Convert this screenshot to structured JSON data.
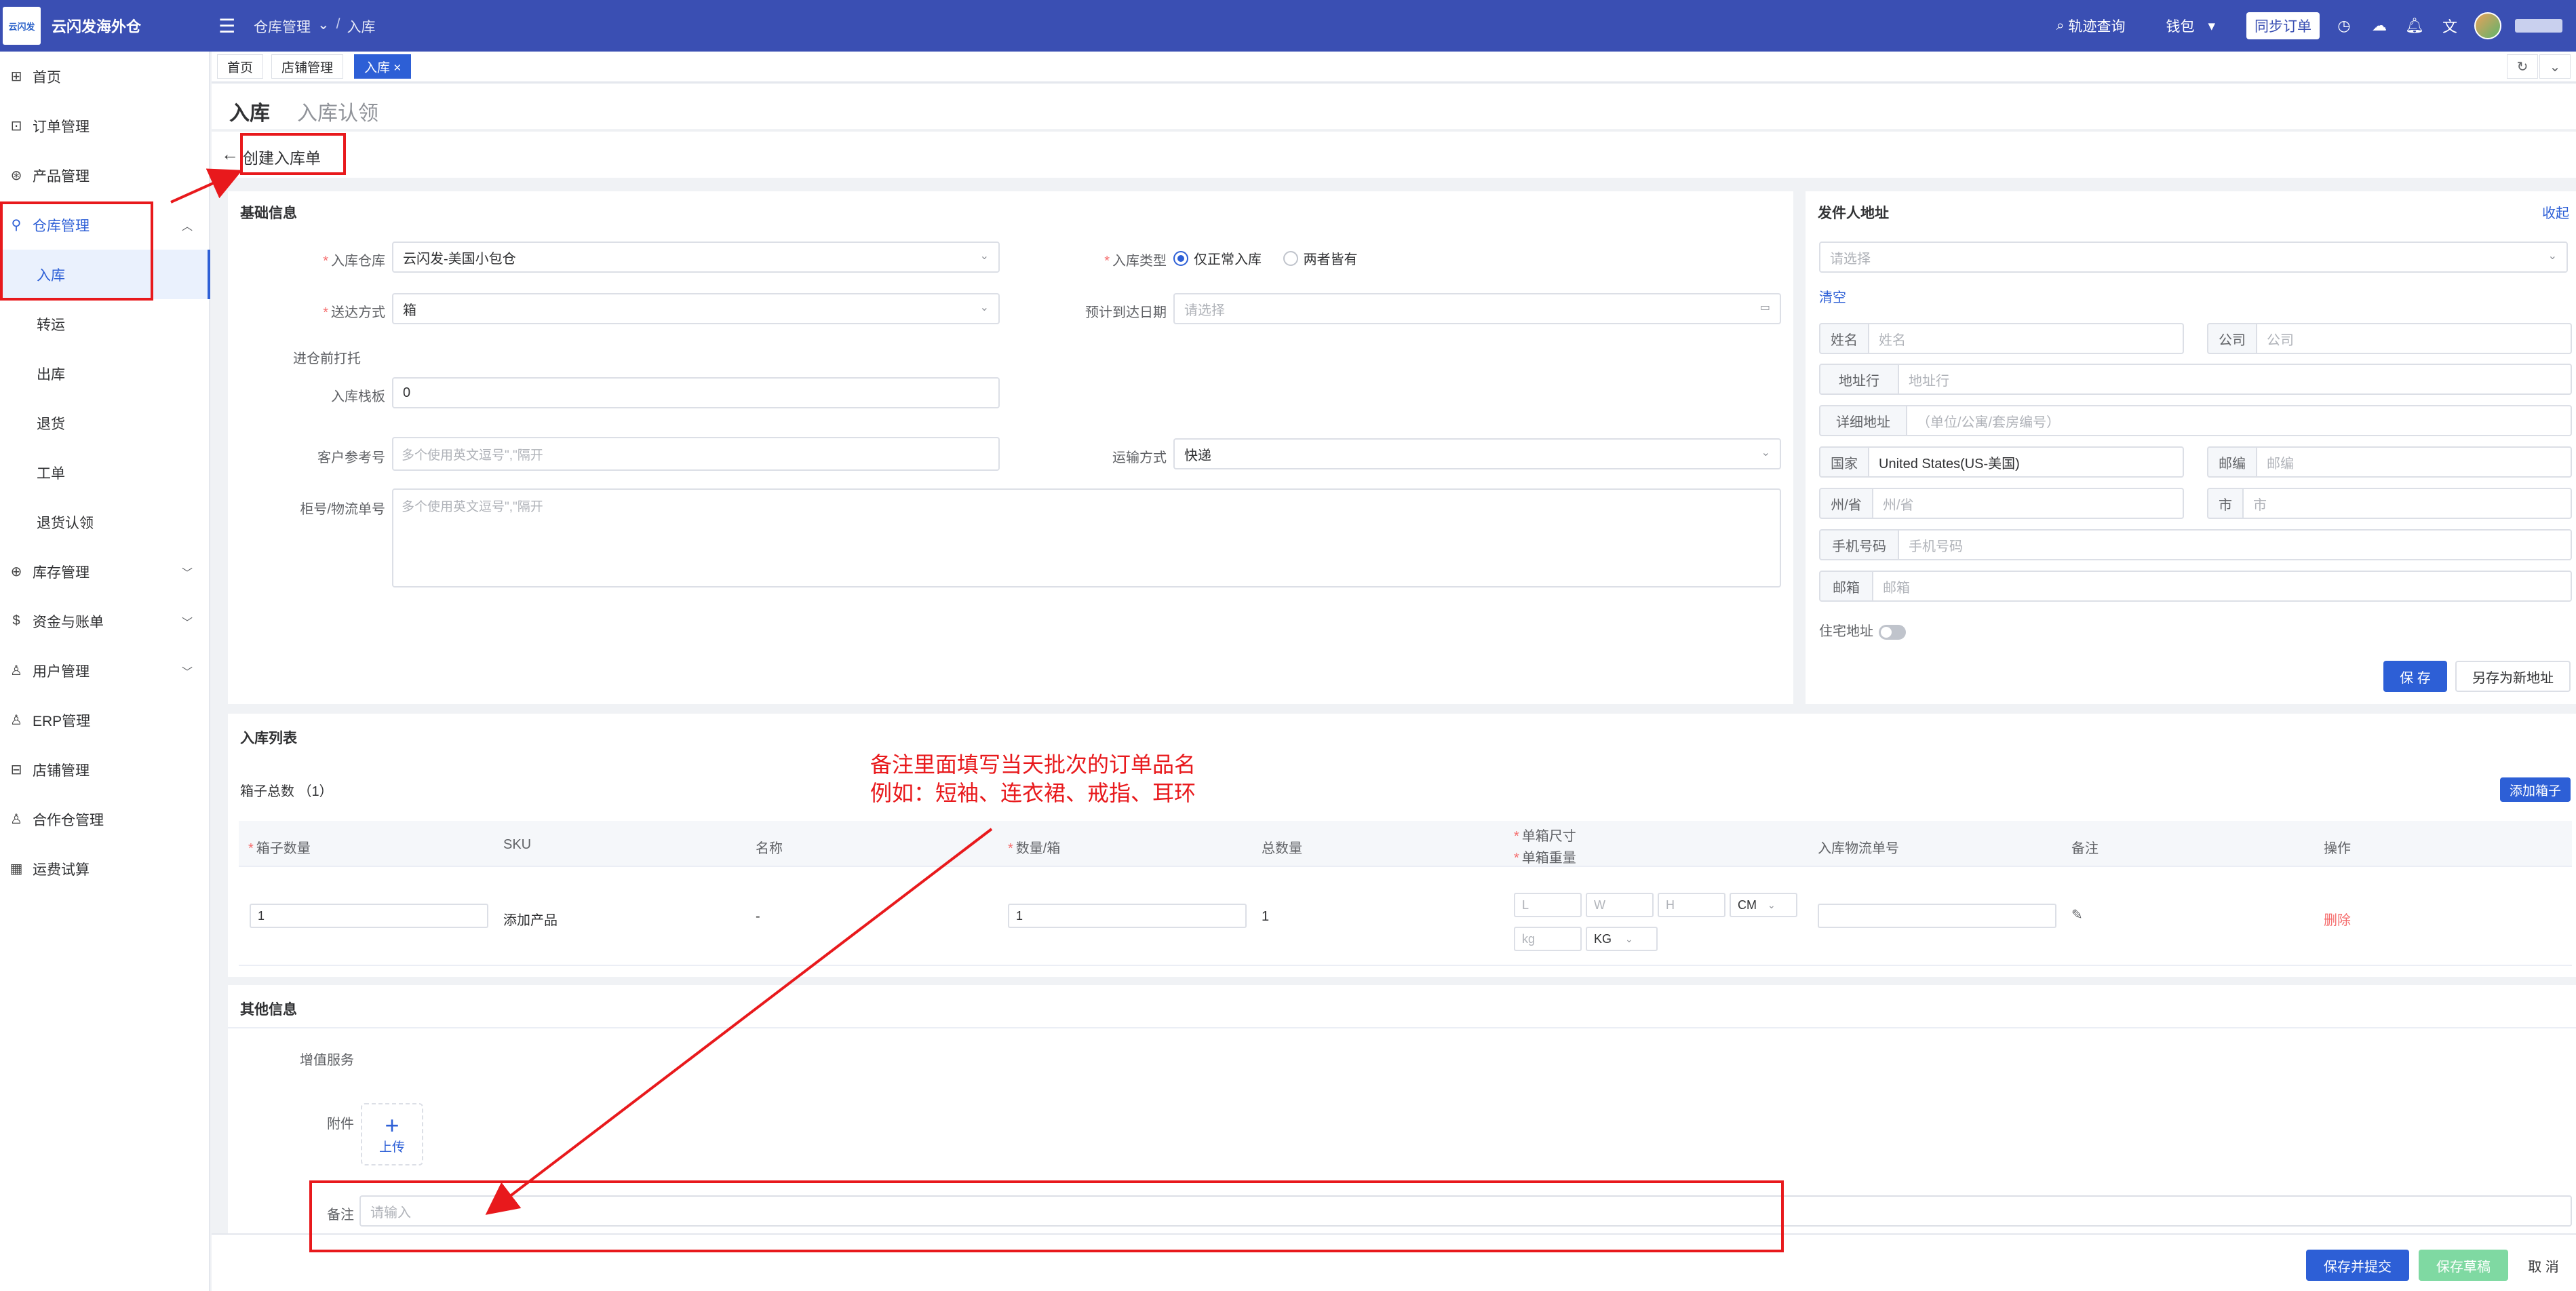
{
  "header": {
    "logo_badge": "云闪发",
    "app_name": "云闪发海外仓",
    "breadcrumb": [
      "仓库管理",
      "入库"
    ],
    "track_query": "轨迹查询",
    "wallet": "钱包",
    "sync_orders": "同步订单",
    "icons": [
      "clock-icon",
      "cloud-upload-icon",
      "bell-icon",
      "translate-icon"
    ]
  },
  "sidebar": {
    "items": [
      {
        "label": "首页",
        "icon": "home-icon"
      },
      {
        "label": "订单管理",
        "icon": "order-icon"
      },
      {
        "label": "产品管理",
        "icon": "product-icon"
      },
      {
        "label": "仓库管理",
        "icon": "warehouse-icon",
        "expanded": true
      },
      {
        "label": "入库",
        "active": true
      },
      {
        "label": "转运"
      },
      {
        "label": "出库"
      },
      {
        "label": "退货"
      },
      {
        "label": "工单"
      },
      {
        "label": "退货认领"
      },
      {
        "label": "库存管理",
        "icon": "inventory-icon"
      },
      {
        "label": "资金与账单",
        "icon": "finance-icon"
      },
      {
        "label": "用户管理",
        "icon": "user-icon"
      },
      {
        "label": "ERP管理",
        "icon": "erp-icon"
      },
      {
        "label": "店铺管理",
        "icon": "shop-icon"
      },
      {
        "label": "合作仓管理",
        "icon": "partner-icon"
      },
      {
        "label": "运费试算",
        "icon": "calculator-icon"
      }
    ]
  },
  "tabs": [
    {
      "label": "首页"
    },
    {
      "label": "店铺管理"
    },
    {
      "label": "入库 ×",
      "active": true
    }
  ],
  "page": {
    "tab_inbound": "入库",
    "tab_claim": "入库认领",
    "create_title": "创建入库单"
  },
  "basic": {
    "title": "基础信息",
    "warehouse_label": "入库仓库",
    "warehouse_value": "云闪发-美国小包仓",
    "type_label": "入库类型",
    "type_options": [
      "仅正常入库",
      "两者皆有"
    ],
    "type_selected": "仅正常入库",
    "delivery_label": "送达方式",
    "delivery_value": "箱",
    "eta_label": "预计到达日期",
    "eta_placeholder": "请选择",
    "pallet_section": "进仓前打托",
    "pallet_label": "入库栈板",
    "pallet_value": "0",
    "ref_label": "客户参考号",
    "ref_placeholder": "多个使用英文逗号\",\"隔开",
    "transport_label": "运输方式",
    "transport_value": "快递",
    "container_label": "柜号/物流单号",
    "container_placeholder": "多个使用英文逗号\",\"隔开"
  },
  "sender": {
    "title": "发件人地址",
    "collapse": "收起",
    "select_placeholder": "请选择",
    "clear": "清空",
    "name_label": "姓名",
    "name_placeholder": "姓名",
    "company_label": "公司",
    "company_placeholder": "公司",
    "address_label": "地址行",
    "address_placeholder": "地址行",
    "detail_label": "详细地址",
    "detail_placeholder": "（单位/公寓/套房编号）",
    "country_label": "国家",
    "country_value": "United States(US-美国)",
    "zip_label": "邮编",
    "zip_placeholder": "邮编",
    "state_label": "州/省",
    "state_placeholder": "州/省",
    "city_label": "市",
    "city_placeholder": "市",
    "phone_label": "手机号码",
    "phone_placeholder": "手机号码",
    "email_label": "邮箱",
    "email_placeholder": "邮箱",
    "residential_label": "住宅地址",
    "save": "保 存",
    "save_new": "另存为新地址"
  },
  "inbound_list": {
    "title": "入库列表",
    "box_total": "箱子总数 （1）",
    "add_box": "添加箱子",
    "columns": {
      "box_qty": "箱子数量",
      "sku": "SKU",
      "name": "名称",
      "qty_per_box": "数量/箱",
      "total_qty": "总数量",
      "box_size": "单箱尺寸",
      "box_weight": "单箱重量",
      "tracking": "入库物流单号",
      "remark": "备注",
      "action": "操作"
    },
    "row": {
      "box_qty": "1",
      "sku_action": "添加产品",
      "name": "-",
      "qty_per_box": "1",
      "total_qty": "1",
      "len_ph": "L",
      "wid_ph": "W",
      "hgt_ph": "H",
      "size_unit": "CM",
      "weight_ph": "kg",
      "weight_unit": "KG",
      "delete": "删除"
    }
  },
  "other": {
    "title": "其他信息",
    "value_added": "增值服务",
    "attachment": "附件",
    "upload": "上传",
    "remark_label": "备注",
    "remark_placeholder": "请输入"
  },
  "footer": {
    "submit": "保存并提交",
    "draft": "保存草稿",
    "cancel": "取 消"
  },
  "annotation": {
    "line1": "备注里面填写当天批次的订单品名",
    "line2": "例如：短袖、连衣裙、戒指、耳环",
    "color": "#e8191c"
  }
}
